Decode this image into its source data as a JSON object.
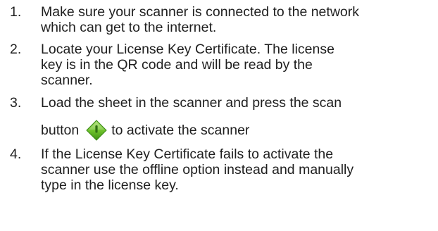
{
  "steps": [
    {
      "number": "1.",
      "lines": [
        "Make sure your scanner is connected to the network",
        "which can get to the internet."
      ]
    },
    {
      "number": "2.",
      "lines": [
        "Locate your License Key Certificate. The license",
        "key is in the QR code and will be read by the",
        "scanner."
      ]
    },
    {
      "number": "3.",
      "lines": [
        "Load the sheet in the scanner and press the scan"
      ],
      "line2_before_icon": "button",
      "line2_after_icon": "to activate the scanner",
      "icon": "scan-button-icon",
      "icon_color": "#6cbf2a"
    },
    {
      "number": "4.",
      "lines": [
        "If the License Key Certificate fails to activate the",
        "scanner use the offline option instead and manually",
        "type in the license key."
      ]
    }
  ]
}
